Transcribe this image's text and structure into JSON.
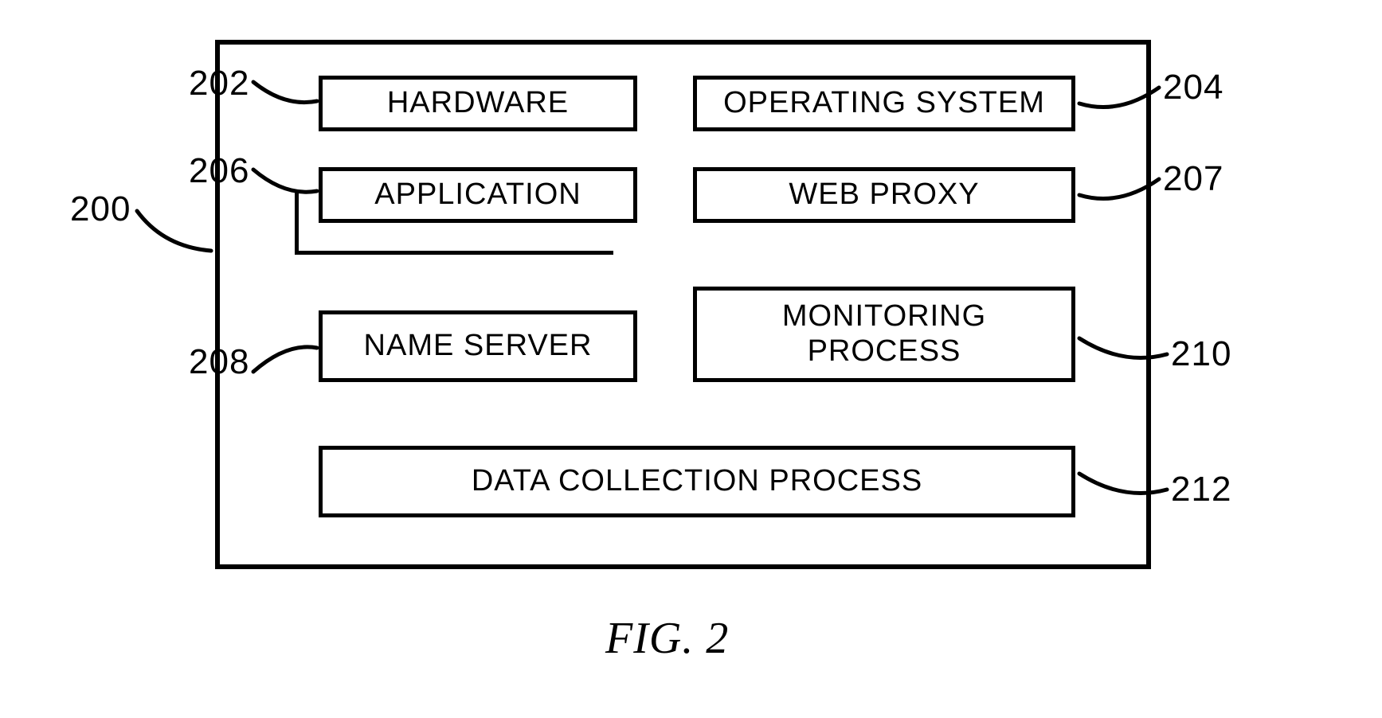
{
  "blocks": {
    "hardware": {
      "label": "HARDWARE",
      "ref": "202"
    },
    "os": {
      "label": "OPERATING SYSTEM",
      "ref": "204"
    },
    "app": {
      "label": "APPLICATION",
      "ref": "206"
    },
    "proxy": {
      "label": "WEB PROXY",
      "ref": "207"
    },
    "nameserver": {
      "label": "NAME SERVER",
      "ref": "208"
    },
    "monitor": {
      "label": "MONITORING\nPROCESS",
      "ref": "210"
    },
    "datacoll": {
      "label": "DATA COLLECTION PROCESS",
      "ref": "212"
    }
  },
  "container_ref": "200",
  "caption": "FIG. 2"
}
